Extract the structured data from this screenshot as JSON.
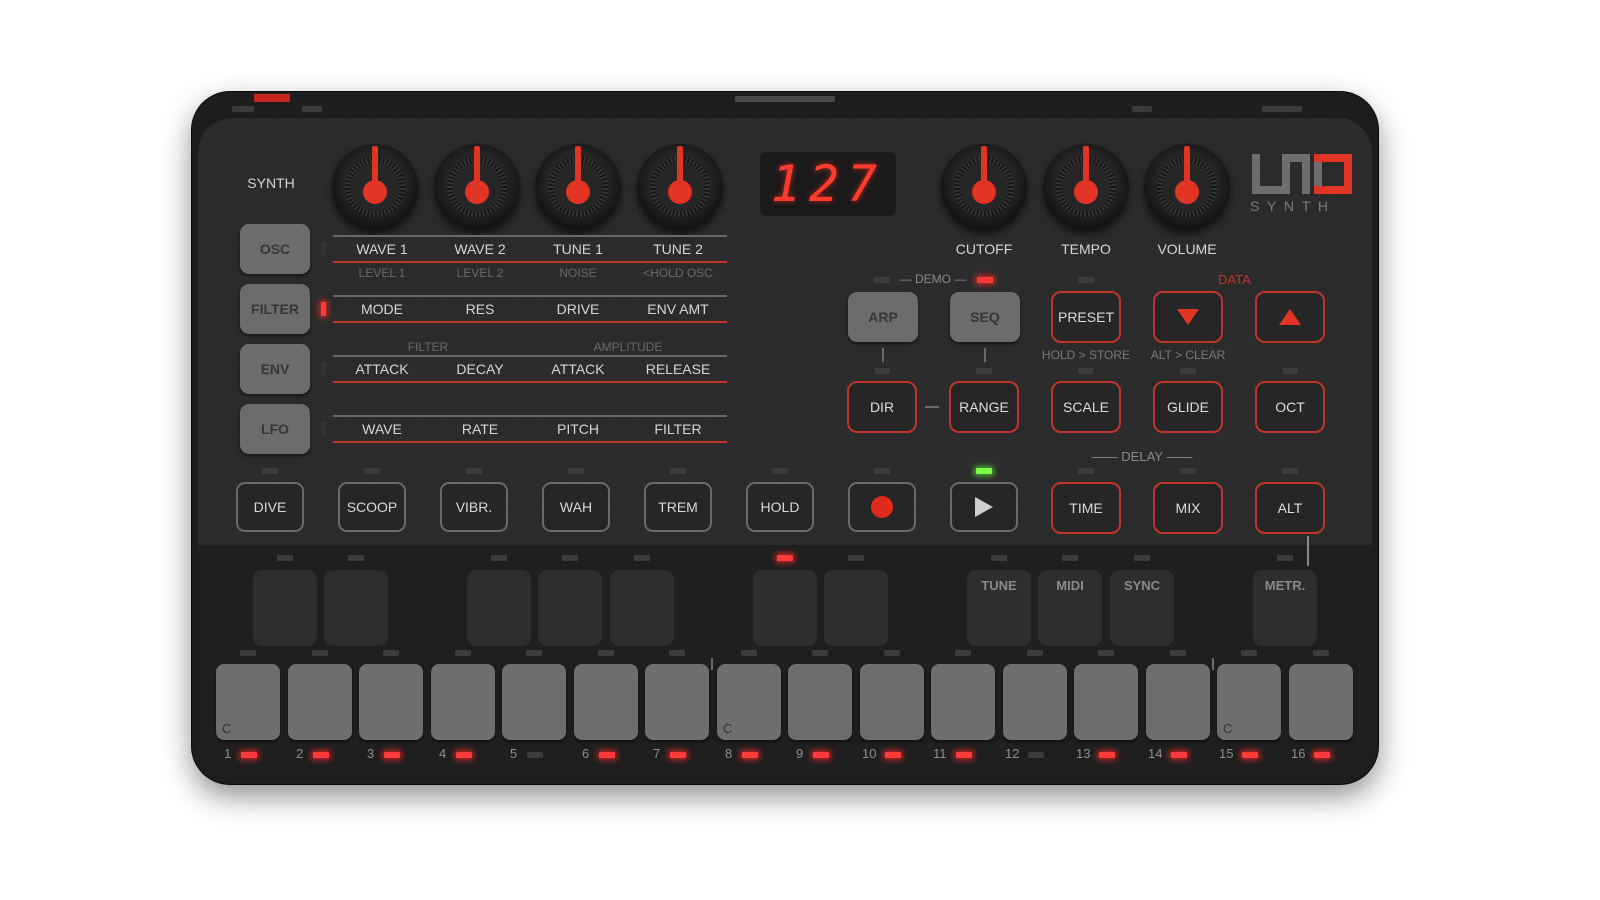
{
  "device": {
    "brand_logo": "UNO",
    "brand_sub": "S Y N T H",
    "accent_color": "#e23424",
    "section_title": "SYNTH"
  },
  "display": {
    "value": "127"
  },
  "knobs": {
    "left": [
      {
        "name": "wave1",
        "value_fraction": 0.5
      },
      {
        "name": "wave2",
        "value_fraction": 0.5
      },
      {
        "name": "tune1",
        "value_fraction": 0.5
      },
      {
        "name": "tune2",
        "value_fraction": 0.5
      }
    ],
    "right": [
      {
        "label": "CUTOFF",
        "value_fraction": 0.5
      },
      {
        "label": "TEMPO",
        "value_fraction": 0.5
      },
      {
        "label": "VOLUME",
        "value_fraction": 0.5
      }
    ]
  },
  "sections": [
    {
      "button": "OSC",
      "active": false,
      "header": [
        "",
        ""
      ],
      "params": [
        "WAVE 1",
        "WAVE 2",
        "TUNE 1",
        "TUNE 2"
      ],
      "sub": [
        "LEVEL 1",
        "LEVEL 2",
        "NOISE",
        "<HOLD OSC"
      ]
    },
    {
      "button": "FILTER",
      "active": true,
      "header": [
        "",
        ""
      ],
      "params": [
        "MODE",
        "RES",
        "DRIVE",
        "ENV AMT"
      ],
      "sub": []
    },
    {
      "button": "ENV",
      "active": false,
      "header": [
        "FILTER",
        "AMPLITUDE"
      ],
      "params": [
        "ATTACK",
        "DECAY",
        "ATTACK",
        "RELEASE"
      ],
      "sub": []
    },
    {
      "button": "LFO",
      "active": false,
      "header": [
        "",
        ""
      ],
      "params": [
        "WAVE",
        "RATE",
        "PITCH",
        "FILTER"
      ],
      "sub": []
    }
  ],
  "mode_buttons": {
    "demo_label": "DEMO",
    "arp": "ARP",
    "seq": "SEQ",
    "dir": "DIR",
    "range": "RANGE",
    "demo_led_on": true
  },
  "data_section": {
    "label": "DATA",
    "preset": "PRESET",
    "preset_sub": "HOLD > STORE",
    "down_sub": "ALT > CLEAR",
    "down_icon": "triangle-down",
    "up_icon": "triangle-up"
  },
  "func_buttons": {
    "scale": "SCALE",
    "glide": "GLIDE",
    "oct": "OCT"
  },
  "delay": {
    "label": "DELAY",
    "time": "TIME",
    "mix": "MIX"
  },
  "alt": "ALT",
  "performance": [
    "DIVE",
    "SCOOP",
    "VIBR.",
    "WAH",
    "TREM",
    "HOLD"
  ],
  "transport": {
    "record_icon": "record",
    "play_icon": "play",
    "play_led": "green"
  },
  "upper_pads": [
    {
      "label": "",
      "led": "off"
    },
    {
      "label": "",
      "led": "off"
    },
    {
      "label": "",
      "led": "off"
    },
    {
      "label": "",
      "led": "off"
    },
    {
      "label": "",
      "led": "off"
    },
    {
      "label": "",
      "led": "red"
    },
    {
      "label": "",
      "led": "off"
    },
    {
      "label": "TUNE",
      "led": "off"
    },
    {
      "label": "MIDI",
      "led": "off"
    },
    {
      "label": "SYNC",
      "led": "off"
    },
    {
      "label": "METR.",
      "led": "off"
    }
  ],
  "steps": [
    {
      "num": "1",
      "note": "C",
      "led": "red"
    },
    {
      "num": "2",
      "note": "",
      "led": "red"
    },
    {
      "num": "3",
      "note": "",
      "led": "red"
    },
    {
      "num": "4",
      "note": "",
      "led": "red"
    },
    {
      "num": "5",
      "note": "",
      "led": "off"
    },
    {
      "num": "6",
      "note": "",
      "led": "red"
    },
    {
      "num": "7",
      "note": "",
      "led": "red"
    },
    {
      "num": "8",
      "note": "C",
      "led": "red"
    },
    {
      "num": "9",
      "note": "",
      "led": "red"
    },
    {
      "num": "10",
      "note": "",
      "led": "red"
    },
    {
      "num": "11",
      "note": "",
      "led": "red"
    },
    {
      "num": "12",
      "note": "",
      "led": "off"
    },
    {
      "num": "13",
      "note": "",
      "led": "red"
    },
    {
      "num": "14",
      "note": "",
      "led": "red"
    },
    {
      "num": "15",
      "note": "C",
      "led": "red"
    },
    {
      "num": "16",
      "note": "",
      "led": "red"
    }
  ]
}
